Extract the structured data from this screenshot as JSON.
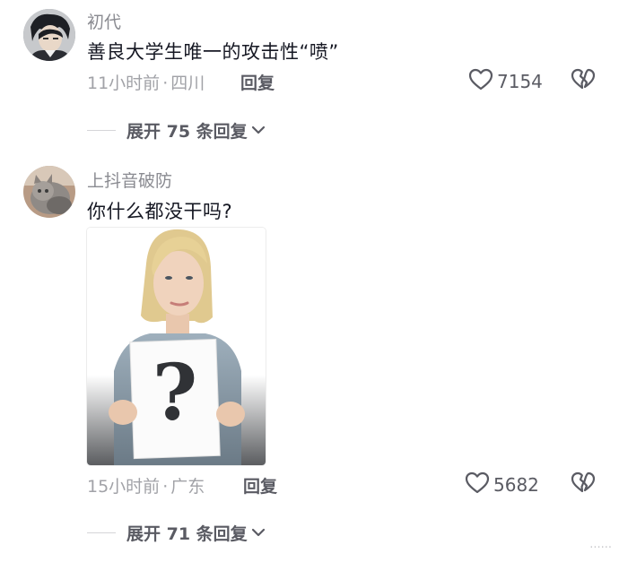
{
  "comments": [
    {
      "username": "初代",
      "text": "善良大学生唯一的攻击性“喷”",
      "time": "11小时前",
      "separator": "·",
      "location": "四川",
      "reply_label": "回复",
      "likes": "7154",
      "expand_label": "展开 75 条回复"
    },
    {
      "username": "上抖音破防",
      "text": "你什么都没干吗?",
      "time": "15小时前",
      "separator": "·",
      "location": "广东",
      "reply_label": "回复",
      "likes": "5682",
      "expand_label": "展开 71 条回复"
    }
  ],
  "icons": {
    "like": "heart-outline-icon",
    "dislike": "broken-heart-icon",
    "expand": "chevron-down-icon"
  },
  "colors": {
    "text": "#161823",
    "secondary": "#8a8b91",
    "meta": "#a1a2a7",
    "action": "#5a5b63"
  },
  "watermark": "......"
}
